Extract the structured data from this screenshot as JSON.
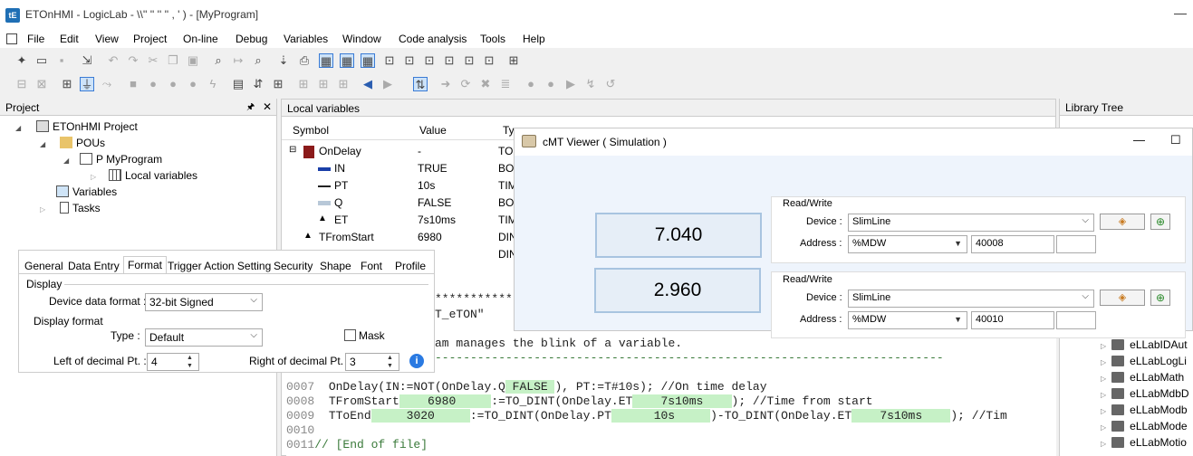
{
  "window": {
    "title": "ETOnHMI - LogicLab - \\\\'' '' '' '' , ' ) - [MyProgram]",
    "app_icon": "tE",
    "min": "—"
  },
  "menu": [
    "File",
    "Edit",
    "View",
    "Project",
    "On-line",
    "Debug",
    "Variables",
    "Window",
    "Code analysis",
    "Tools",
    "Help"
  ],
  "project_panel": {
    "title": "Project",
    "pin": "🖈",
    "close": "✕",
    "tree": {
      "root": "ETOnHMI Project",
      "pous": "POUs",
      "program": "MyProgram",
      "program_prefix": "P",
      "local_vars": "Local variables",
      "variables": "Variables",
      "tasks": "Tasks"
    }
  },
  "local_vars": {
    "title": "Local variables",
    "cols": {
      "symbol": "Symbol",
      "value": "Value",
      "type": "Typ"
    },
    "rows": [
      {
        "symbol": "OnDelay",
        "value": "-",
        "type": "TON"
      },
      {
        "symbol": "IN",
        "value": "TRUE",
        "type": "BOO"
      },
      {
        "symbol": "PT",
        "value": "10s",
        "type": "TIM"
      },
      {
        "symbol": "Q",
        "value": "FALSE",
        "type": "BOO"
      },
      {
        "symbol": "ET",
        "value": "7s10ms",
        "type": "TIM"
      },
      {
        "symbol": "TFromStart",
        "value": "6980",
        "type": "DIN"
      },
      {
        "symbol": "",
        "value": "",
        "type": "DIN"
      }
    ]
  },
  "code": {
    "l_stars": "***********",
    "l_eton": "T_eTON\"",
    "l_comment": "am manages the blink of a variable.",
    "l_dash": "------------------------------------------------------------------------",
    "lines": [
      {
        "no": "0007",
        "a": "  OnDelay(IN:=NOT(OnDelay.Q",
        "h1": " FALSE ",
        "b": "), PT:=T#10s); //On time delay"
      },
      {
        "no": "0008",
        "a": "  TFromStart",
        "h1": "    6980     ",
        "b": ":=TO_DINT(OnDelay.ET",
        "h2": "    7s10ms    ",
        "c": "); //Time from start"
      },
      {
        "no": "0009",
        "a": "  TToEnd",
        "h1": "     3020     ",
        "b": ":=TO_DINT(OnDelay.PT",
        "h2": "      10s     ",
        "c": ")-TO_DINT(OnDelay.ET",
        "h3": "    7s10ms    ",
        "d": "); //Tim"
      },
      {
        "no": "0010",
        "a": ""
      },
      {
        "no": "0011",
        "a": "// [End of file]"
      }
    ]
  },
  "library": {
    "title": "Library Tree",
    "items": [
      "eLLabIDAut",
      "eLLabLogLi",
      "eLLabMath",
      "eLLabMdbD",
      "eLLabModb",
      "eLLabMode",
      "eLLabMotio"
    ]
  },
  "props": {
    "tabs": [
      "General",
      "Data Entry",
      "Format",
      "Trigger Action Setting",
      "Security",
      "Shape",
      "Font",
      "Profile"
    ],
    "display": "Display",
    "device_format_label": "Device data format :",
    "device_format": "32-bit Signed",
    "display_format": "Display format",
    "type_label": "Type :",
    "type": "Default",
    "mask": "Mask",
    "left_label": "Left of decimal Pt. :",
    "left": "4",
    "right_label": "Right of decimal Pt. :",
    "right": "3",
    "info": "i"
  },
  "cmt": {
    "title": "cMT Viewer ( Simulation )",
    "min": "—",
    "max": "☐",
    "display1": "7.040",
    "display2": "2.960",
    "rw1": {
      "title": "Read/Write",
      "device_label": "Device :",
      "device": "SlimLine",
      "address_label": "Address :",
      "addr_type": "%MDW",
      "addr": "40008"
    },
    "rw2": {
      "title": "Read/Write",
      "device_label": "Device :",
      "device": "SlimLine",
      "address_label": "Address :",
      "addr_type": "%MDW",
      "addr": "40010"
    }
  }
}
